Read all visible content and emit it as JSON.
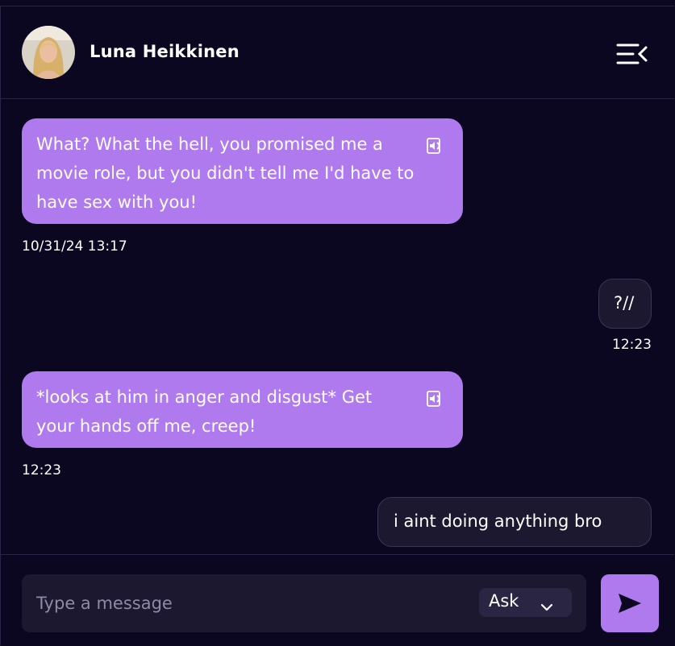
{
  "header": {
    "contact_name": "Luna Heikkinen",
    "avatar_icon": "profile-photo",
    "menu_icon": "collapse-menu-icon"
  },
  "messages": [
    {
      "sender": "character",
      "text": "What? What the hell, you promised me a movie role, but you didn't tell me I'd have to have sex with you!",
      "time": "10/31/24 13:17"
    },
    {
      "sender": "user",
      "text": "?//",
      "time": "12:23"
    },
    {
      "sender": "character",
      "text": "*looks at him in anger and disgust* Get your hands off me, creep!",
      "time": "12:23"
    },
    {
      "sender": "user",
      "text": "i aint doing anything bro"
    }
  ],
  "composer": {
    "placeholder": "Type a message",
    "mode": "Ask",
    "send_icon": "send-icon"
  },
  "colors": {
    "background": "#0b0720",
    "incoming_bubble": "#b07aef",
    "outgoing_bubble": "#1c1830",
    "accent": "#b07aef"
  }
}
